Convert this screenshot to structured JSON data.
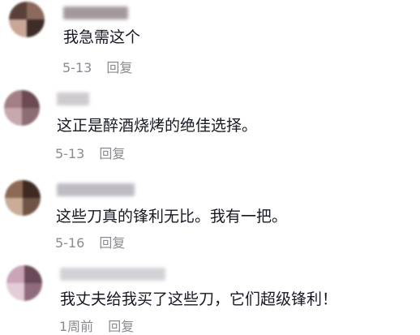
{
  "comments": [
    {
      "text": "我急需这个",
      "date": "5-13",
      "reply_label": "回复",
      "avatar_colors": [
        "#5a4038",
        "#8b6a5c",
        "#c9a698",
        "#3d2c28"
      ],
      "username_color": "#9a8f92"
    },
    {
      "text": "这正是醉酒烧烤的绝佳选择。",
      "date": "5-13",
      "reply_label": "回复",
      "avatar_colors": [
        "#a37f86",
        "#6b4a52",
        "#c6a8ae",
        "#8d6d74"
      ],
      "username_color": "#c9c5c8"
    },
    {
      "text": "这些刀真的锋利无比。我有一把。",
      "date": "5-16",
      "reply_label": "回复",
      "avatar_colors": [
        "#8d6a55",
        "#3e2a22",
        "#c9ad98",
        "#6f5446"
      ],
      "username_color": "#b7b4bc"
    },
    {
      "text": "我丈夫给我买了这些刀，它们超级锋利！",
      "date": "1周前",
      "reply_label": "回复",
      "avatar_colors": [
        "#c9a5b6",
        "#6a4a58",
        "#e4cdd7",
        "#8f6b7c"
      ],
      "username_color": "#cfcdd2"
    }
  ]
}
